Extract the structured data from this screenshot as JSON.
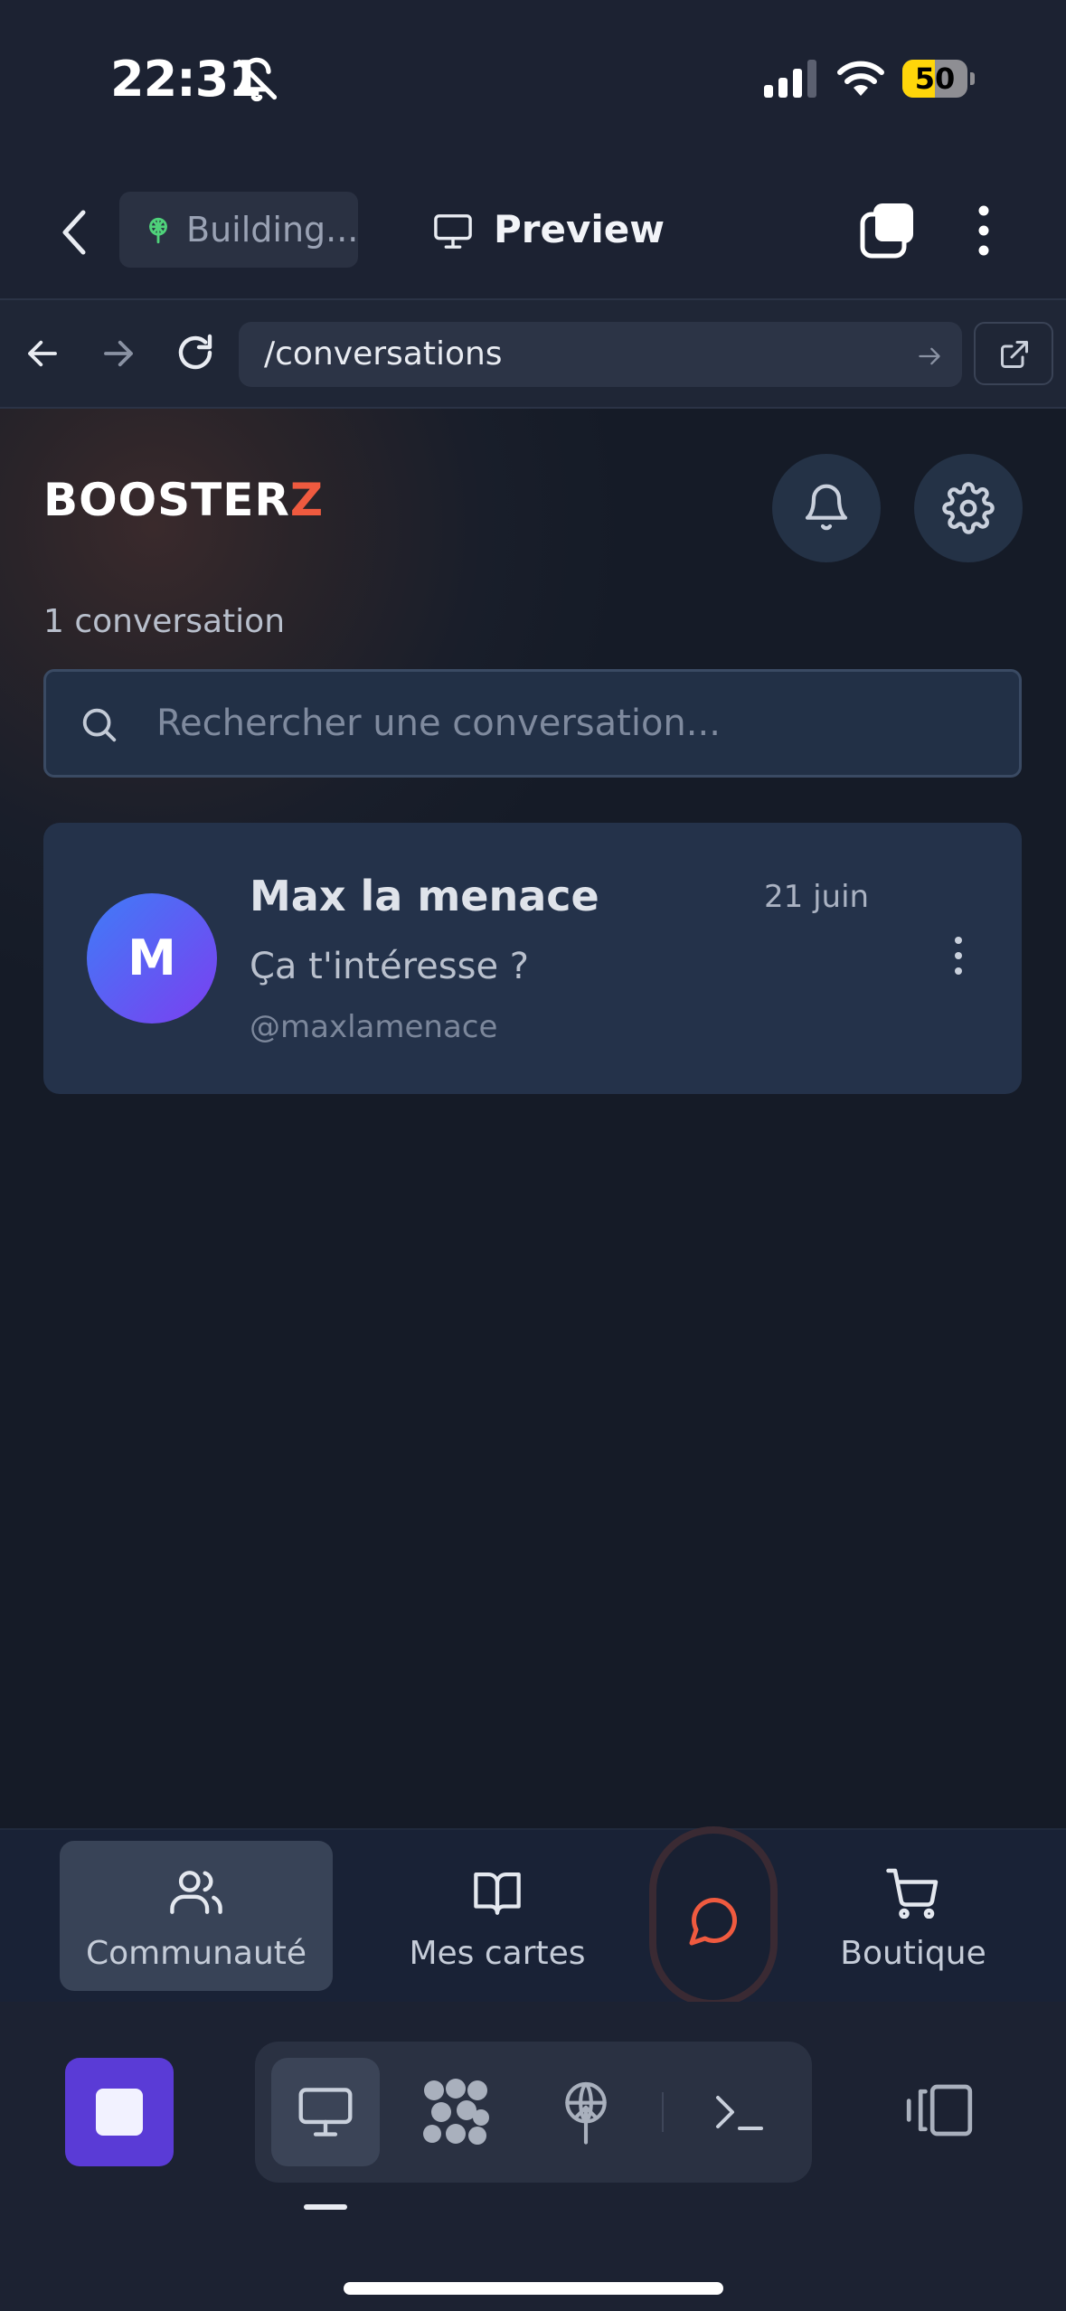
{
  "status_bar": {
    "time": "22:31",
    "battery_percent": "50",
    "battery_level": 0.5,
    "signal_bars": 3,
    "icons": [
      "bell-slash-icon",
      "cellular-signal-icon",
      "wifi-icon",
      "battery-icon"
    ]
  },
  "topbar": {
    "building_label": "Building...",
    "preview_label": "Preview"
  },
  "urlbar": {
    "url": "/conversations"
  },
  "app": {
    "brand_main": "BOOSTER",
    "brand_accent": "Z",
    "accent_color": "#ef5a3f",
    "conversation_count": "1 conversation",
    "search": {
      "placeholder": "Rechercher une conversation..."
    },
    "conversations": [
      {
        "initial": "M",
        "name": "Max la menace",
        "date": "21 juin",
        "preview": "Ça t'intéresse ?",
        "handle": "@maxlamenace"
      }
    ]
  },
  "tabbar": {
    "community": "Communauté",
    "cards": "Mes cartes",
    "shop": "Boutique",
    "active": "community"
  },
  "ide_toolbar": {
    "tools": [
      "preview-icon",
      "agents-icon",
      "deploy-icon",
      "terminal-icon"
    ],
    "stop_color": "#5a3bd6"
  }
}
